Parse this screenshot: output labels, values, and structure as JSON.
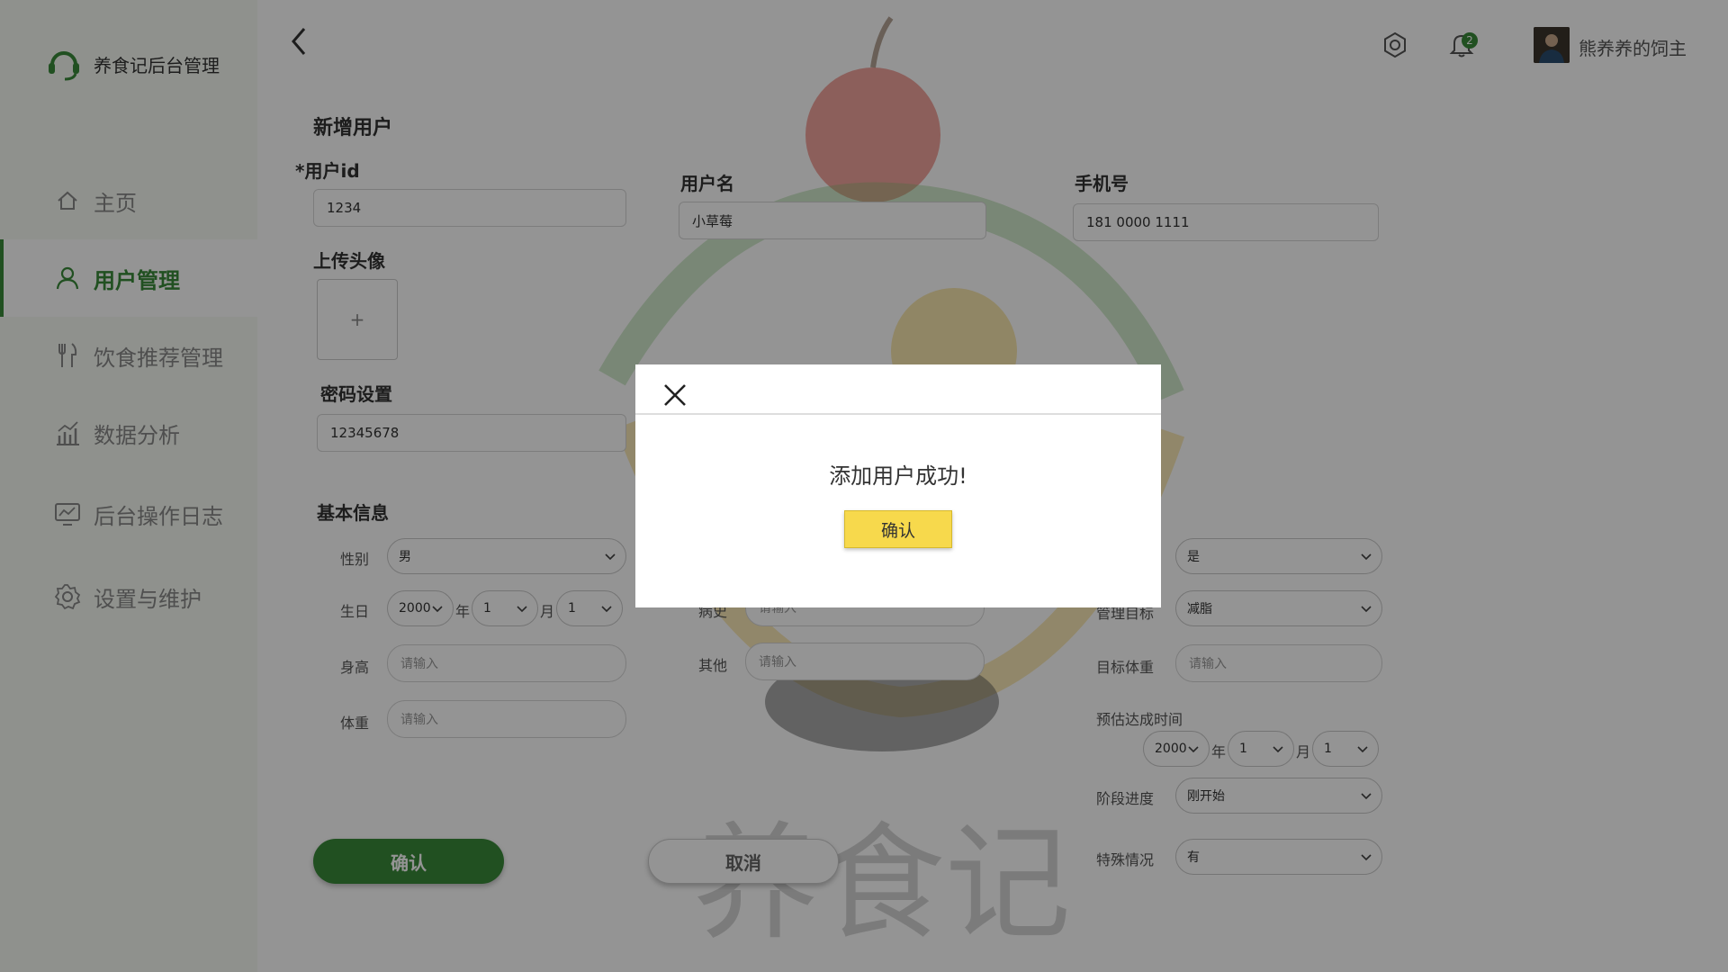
{
  "app": {
    "title": "养食记后台管理"
  },
  "sidebar": {
    "items": [
      {
        "label": "主页"
      },
      {
        "label": "用户管理"
      },
      {
        "label": "饮食推荐管理"
      },
      {
        "label": "数据分析"
      },
      {
        "label": "后台操作日志"
      },
      {
        "label": "设置与维护"
      }
    ],
    "active": "用户管理"
  },
  "header": {
    "notification_count": "2",
    "user_name": "熊养养的饲主"
  },
  "form": {
    "title": "新增用户",
    "required_mark": "*",
    "user_id": {
      "label": "用户id",
      "value": "1234"
    },
    "username": {
      "label": "用户名",
      "value": "小草莓"
    },
    "phone": {
      "label": "手机号",
      "value": "181 0000 1111"
    },
    "avatar": {
      "label": "上传头像",
      "plus": "+"
    },
    "password": {
      "label": "密码设置",
      "value": "12345678"
    },
    "basic_info": {
      "label": "基本信息",
      "gender": {
        "label": "性别",
        "value": "男"
      },
      "birthday": {
        "label": "生日",
        "year": "2000",
        "year_unit": "年",
        "month": "1",
        "month_unit": "月",
        "day": "1"
      },
      "height": {
        "label": "身高",
        "placeholder": "请输入"
      },
      "weight": {
        "label": "体重",
        "placeholder": "请输入"
      }
    },
    "middle": {
      "history": {
        "label": "病史",
        "placeholder": "请输入"
      },
      "other": {
        "label": "其他",
        "placeholder": "请输入"
      }
    },
    "right": {
      "first_select": {
        "value": "是"
      },
      "goal": {
        "label": "管理目标",
        "value": "减脂"
      },
      "target_weight": {
        "label": "目标体重",
        "placeholder": "请输入"
      },
      "eta": {
        "label": "预估达成时间",
        "year": "2000",
        "year_unit": "年",
        "month": "1",
        "month_unit": "月",
        "day": "1"
      },
      "stage": {
        "label": "阶段进度",
        "value": "刚开始"
      },
      "special": {
        "label": "特殊情况",
        "value": "有"
      }
    },
    "confirm_label": "确认",
    "cancel_label": "取消"
  },
  "modal": {
    "message": "添加用户成功!",
    "confirm_label": "确认"
  },
  "colors": {
    "brand_green": "#3a8a3a",
    "modal_button": "#f7d94c",
    "overlay": "rgba(0,0,0,0.42)"
  }
}
